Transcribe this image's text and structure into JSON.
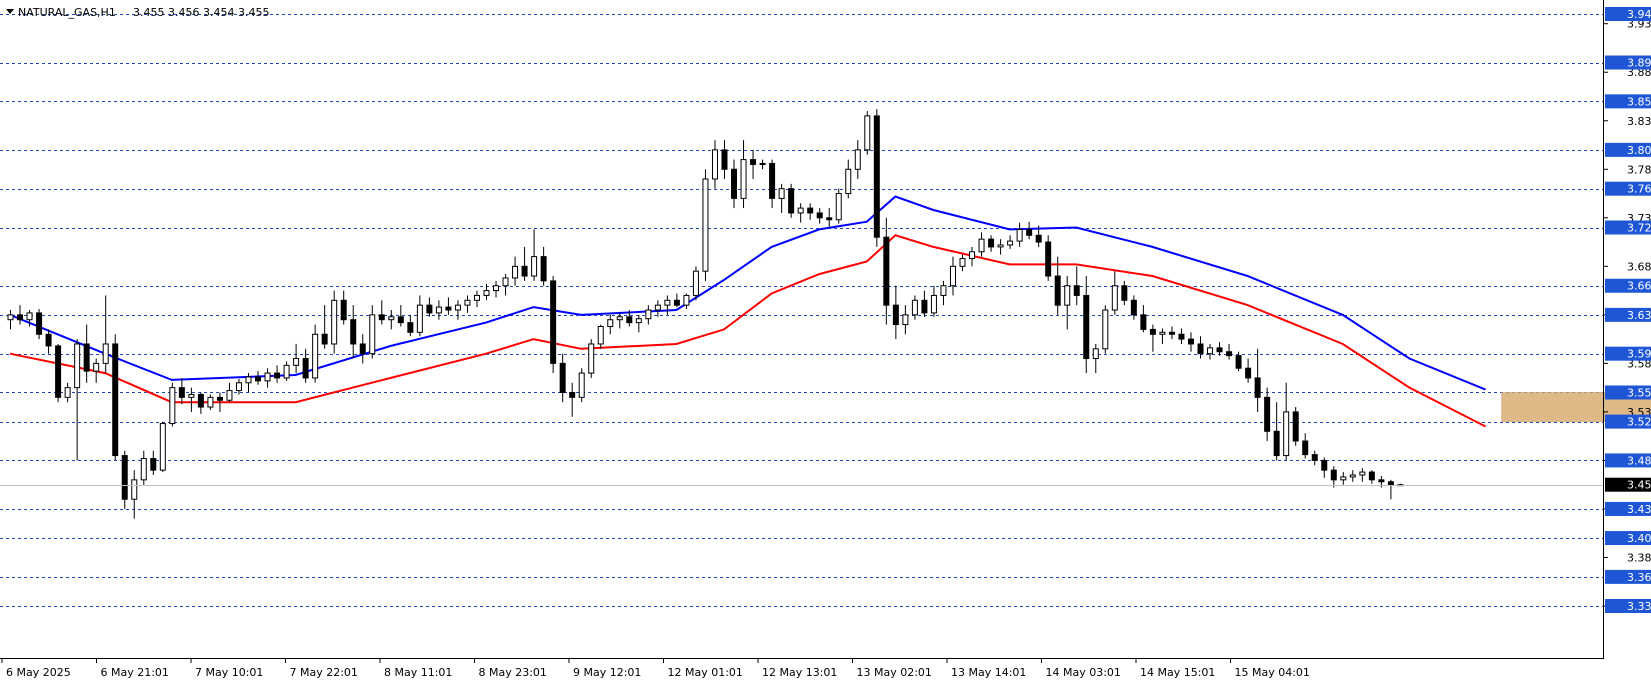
{
  "header": {
    "symbol": "NATURAL_GAS,H1",
    "ohlc": "3.455 3.456 3.454 3.455"
  },
  "colors": {
    "ema_fast": "#0000ff",
    "ema_slow": "#ff0000",
    "level_line": "#2244bb",
    "level_label_bg": "#1e56d6",
    "zone": "#deb887",
    "bid_label_bg": "#000000"
  },
  "chart_data": {
    "type": "candlestick",
    "ylim": [
      3.315,
      3.945
    ],
    "bid": 3.455,
    "price_ticks": [
      "3.930",
      "3.880",
      "3.830",
      "3.780",
      "3.730",
      "3.680",
      "3.630",
      "3.580",
      "3.530",
      "3.480",
      "3.430",
      "3.380",
      "3.330"
    ],
    "levels": [
      "3.940",
      "3.890",
      "3.850",
      "3.800",
      "3.760",
      "3.720",
      "3.660",
      "3.630",
      "3.590",
      "3.550",
      "3.520",
      "3.480",
      "3.430",
      "3.400",
      "3.360",
      "3.330"
    ],
    "time_labels": [
      "6 May 2025",
      "6 May 21:01",
      "7 May 10:01",
      "7 May 22:01",
      "8 May 11:01",
      "8 May 23:01",
      "9 May 12:01",
      "12 May 01:01",
      "12 May 13:01",
      "13 May 02:01",
      "13 May 14:01",
      "14 May 03:01",
      "14 May 15:01",
      "15 May 04:01"
    ],
    "zone": {
      "from_bar": 157,
      "to_bar": 205,
      "high": 3.55,
      "low": 3.52
    },
    "candles": [
      [
        3.625,
        3.635,
        3.615,
        3.63
      ],
      [
        3.63,
        3.64,
        3.62,
        3.625
      ],
      [
        3.625,
        3.635,
        3.618,
        3.632
      ],
      [
        3.632,
        3.636,
        3.605,
        3.61
      ],
      [
        3.61,
        3.615,
        3.59,
        3.598
      ],
      [
        3.598,
        3.6,
        3.54,
        3.545
      ],
      [
        3.545,
        3.56,
        3.54,
        3.555
      ],
      [
        3.555,
        3.605,
        3.48,
        3.6
      ],
      [
        3.6,
        3.62,
        3.56,
        3.572
      ],
      [
        3.572,
        3.585,
        3.56,
        3.58
      ],
      [
        3.58,
        3.65,
        3.57,
        3.6
      ],
      [
        3.6,
        3.61,
        3.48,
        3.485
      ],
      [
        3.485,
        3.49,
        3.43,
        3.44
      ],
      [
        3.44,
        3.47,
        3.42,
        3.46
      ],
      [
        3.46,
        3.49,
        3.455,
        3.482
      ],
      [
        3.482,
        3.49,
        3.465,
        3.47
      ],
      [
        3.47,
        3.52,
        3.468,
        3.518
      ],
      [
        3.518,
        3.56,
        3.515,
        3.555
      ],
      [
        3.555,
        3.565,
        3.538,
        3.545
      ],
      [
        3.545,
        3.555,
        3.53,
        3.548
      ],
      [
        3.548,
        3.55,
        3.528,
        3.535
      ],
      [
        3.535,
        3.548,
        3.532,
        3.545
      ],
      [
        3.545,
        3.55,
        3.53,
        3.542
      ],
      [
        3.542,
        3.56,
        3.54,
        3.552
      ],
      [
        3.552,
        3.564,
        3.548,
        3.56
      ],
      [
        3.56,
        3.57,
        3.55,
        3.566
      ],
      [
        3.566,
        3.572,
        3.558,
        3.562
      ],
      [
        3.562,
        3.575,
        3.555,
        3.57
      ],
      [
        3.57,
        3.578,
        3.56,
        3.565
      ],
      [
        3.565,
        3.582,
        3.562,
        3.578
      ],
      [
        3.578,
        3.6,
        3.57,
        3.585
      ],
      [
        3.585,
        3.595,
        3.56,
        3.565
      ],
      [
        3.565,
        3.62,
        3.56,
        3.61
      ],
      [
        3.61,
        3.64,
        3.595,
        3.6
      ],
      [
        3.6,
        3.655,
        3.59,
        3.645
      ],
      [
        3.645,
        3.655,
        3.62,
        3.625
      ],
      [
        3.625,
        3.64,
        3.585,
        3.6
      ],
      [
        3.6,
        3.61,
        3.58,
        3.59
      ],
      [
        3.59,
        3.64,
        3.585,
        3.63
      ],
      [
        3.63,
        3.645,
        3.62,
        3.625
      ],
      [
        3.625,
        3.635,
        3.615,
        3.628
      ],
      [
        3.628,
        3.64,
        3.618,
        3.622
      ],
      [
        3.622,
        3.63,
        3.608,
        3.612
      ],
      [
        3.612,
        3.65,
        3.608,
        3.64
      ],
      [
        3.64,
        3.648,
        3.628,
        3.632
      ],
      [
        3.632,
        3.645,
        3.625,
        3.638
      ],
      [
        3.638,
        3.648,
        3.63,
        3.635
      ],
      [
        3.635,
        3.645,
        3.625,
        3.64
      ],
      [
        3.64,
        3.65,
        3.632,
        3.645
      ],
      [
        3.645,
        3.655,
        3.638,
        3.65
      ],
      [
        3.65,
        3.662,
        3.645,
        3.655
      ],
      [
        3.655,
        3.665,
        3.648,
        3.66
      ],
      [
        3.66,
        3.672,
        3.65,
        3.668
      ],
      [
        3.668,
        3.69,
        3.66,
        3.68
      ],
      [
        3.68,
        3.7,
        3.665,
        3.67
      ],
      [
        3.67,
        3.718,
        3.665,
        3.69
      ],
      [
        3.69,
        3.7,
        3.66,
        3.665
      ],
      [
        3.665,
        3.67,
        3.57,
        3.58
      ],
      [
        3.58,
        3.59,
        3.54,
        3.55
      ],
      [
        3.55,
        3.56,
        3.525,
        3.545
      ],
      [
        3.545,
        3.575,
        3.54,
        3.57
      ],
      [
        3.57,
        3.605,
        3.565,
        3.6
      ],
      [
        3.6,
        3.62,
        3.595,
        3.618
      ],
      [
        3.618,
        3.63,
        3.61,
        3.625
      ],
      [
        3.625,
        3.632,
        3.616,
        3.628
      ],
      [
        3.628,
        3.635,
        3.618,
        3.622
      ],
      [
        3.622,
        3.63,
        3.612,
        3.626
      ],
      [
        3.626,
        3.64,
        3.62,
        3.635
      ],
      [
        3.635,
        3.645,
        3.628,
        3.64
      ],
      [
        3.64,
        3.65,
        3.63,
        3.645
      ],
      [
        3.645,
        3.652,
        3.638,
        3.64
      ],
      [
        3.64,
        3.652,
        3.636,
        3.65
      ],
      [
        3.65,
        3.68,
        3.645,
        3.675
      ],
      [
        3.675,
        3.78,
        3.665,
        3.77
      ],
      [
        3.77,
        3.81,
        3.76,
        3.8
      ],
      [
        3.8,
        3.81,
        3.77,
        3.78
      ],
      [
        3.78,
        3.79,
        3.74,
        3.75
      ],
      [
        3.75,
        3.81,
        3.74,
        3.79
      ],
      [
        3.79,
        3.8,
        3.77,
        3.785
      ],
      [
        3.785,
        3.79,
        3.78,
        3.786
      ],
      [
        3.786,
        3.79,
        3.74,
        3.75
      ],
      [
        3.75,
        3.765,
        3.735,
        3.76
      ],
      [
        3.76,
        3.765,
        3.73,
        3.735
      ],
      [
        3.735,
        3.745,
        3.725,
        3.74
      ],
      [
        3.74,
        3.745,
        3.728,
        3.735
      ],
      [
        3.735,
        3.74,
        3.724,
        3.73
      ],
      [
        3.73,
        3.74,
        3.72,
        3.728
      ],
      [
        3.728,
        3.76,
        3.724,
        3.755
      ],
      [
        3.755,
        3.79,
        3.75,
        3.78
      ],
      [
        3.78,
        3.81,
        3.77,
        3.8
      ],
      [
        3.8,
        3.84,
        3.795,
        3.835
      ],
      [
        3.835,
        3.842,
        3.7,
        3.71
      ],
      [
        3.71,
        3.73,
        3.62,
        3.64
      ],
      [
        3.64,
        3.66,
        3.605,
        3.62
      ],
      [
        3.62,
        3.64,
        3.61,
        3.63
      ],
      [
        3.63,
        3.65,
        3.625,
        3.645
      ],
      [
        3.645,
        3.655,
        3.628,
        3.632
      ],
      [
        3.632,
        3.66,
        3.628,
        3.65
      ],
      [
        3.65,
        3.665,
        3.64,
        3.66
      ],
      [
        3.66,
        3.69,
        3.65,
        3.68
      ],
      [
        3.68,
        3.692,
        3.675,
        3.688
      ],
      [
        3.688,
        3.7,
        3.68,
        3.695
      ],
      [
        3.695,
        3.715,
        3.69,
        3.708
      ],
      [
        3.708,
        3.712,
        3.695,
        3.7
      ],
      [
        3.7,
        3.708,
        3.692,
        3.702
      ],
      [
        3.702,
        3.712,
        3.698,
        3.706
      ],
      [
        3.706,
        3.725,
        3.7,
        3.718
      ],
      [
        3.718,
        3.726,
        3.708,
        3.712
      ],
      [
        3.712,
        3.722,
        3.7,
        3.705
      ],
      [
        3.705,
        3.712,
        3.665,
        3.67
      ],
      [
        3.67,
        3.69,
        3.63,
        3.64
      ],
      [
        3.64,
        3.67,
        3.615,
        3.66
      ],
      [
        3.66,
        3.68,
        3.64,
        3.65
      ],
      [
        3.65,
        3.67,
        3.57,
        3.585
      ],
      [
        3.585,
        3.6,
        3.57,
        3.595
      ],
      [
        3.595,
        3.64,
        3.59,
        3.635
      ],
      [
        3.635,
        3.675,
        3.63,
        3.66
      ],
      [
        3.66,
        3.665,
        3.64,
        3.645
      ],
      [
        3.645,
        3.65,
        3.625,
        3.63
      ],
      [
        3.63,
        3.64,
        3.612,
        3.615
      ],
      [
        3.615,
        3.62,
        3.592,
        3.61
      ],
      [
        3.61,
        3.616,
        3.6,
        3.612
      ],
      [
        3.612,
        3.618,
        3.605,
        3.61
      ],
      [
        3.61,
        3.616,
        3.6,
        3.605
      ],
      [
        3.605,
        3.612,
        3.592,
        3.6
      ],
      [
        3.6,
        3.608,
        3.585,
        3.59
      ],
      [
        3.59,
        3.6,
        3.584,
        3.596
      ],
      [
        3.596,
        3.602,
        3.588,
        3.592
      ],
      [
        3.592,
        3.6,
        3.584,
        3.588
      ],
      [
        3.588,
        3.592,
        3.572,
        3.575
      ],
      [
        3.575,
        3.585,
        3.56,
        3.565
      ],
      [
        3.565,
        3.595,
        3.53,
        3.545
      ],
      [
        3.545,
        3.555,
        3.5,
        3.51
      ],
      [
        3.51,
        3.54,
        3.48,
        3.485
      ],
      [
        3.485,
        3.56,
        3.48,
        3.53
      ],
      [
        3.53,
        3.535,
        3.495,
        3.5
      ],
      [
        3.5,
        3.508,
        3.482,
        3.486
      ],
      [
        3.486,
        3.49,
        3.475,
        3.48
      ],
      [
        3.48,
        3.483,
        3.462,
        3.47
      ],
      [
        3.47,
        3.474,
        3.452,
        3.46
      ],
      [
        3.46,
        3.468,
        3.455,
        3.463
      ],
      [
        3.463,
        3.47,
        3.458,
        3.465
      ],
      [
        3.465,
        3.472,
        3.458,
        3.468
      ],
      [
        3.468,
        3.47,
        3.456,
        3.46
      ],
      [
        3.46,
        3.464,
        3.452,
        3.458
      ],
      [
        3.458,
        3.46,
        3.44,
        3.455
      ],
      [
        3.455,
        3.456,
        3.454,
        3.455
      ]
    ],
    "ema_fast": [
      [
        0,
        3.63
      ],
      [
        10,
        3.59
      ],
      [
        17,
        3.563
      ],
      [
        30,
        3.568
      ],
      [
        40,
        3.598
      ],
      [
        50,
        3.622
      ],
      [
        55,
        3.638
      ],
      [
        60,
        3.63
      ],
      [
        70,
        3.635
      ],
      [
        75,
        3.666
      ],
      [
        80,
        3.7
      ],
      [
        85,
        3.718
      ],
      [
        90,
        3.726
      ],
      [
        93,
        3.752
      ],
      [
        97,
        3.738
      ],
      [
        105,
        3.718
      ],
      [
        112,
        3.72
      ],
      [
        120,
        3.7
      ],
      [
        130,
        3.67
      ],
      [
        140,
        3.63
      ],
      [
        147,
        3.585
      ],
      [
        155,
        3.553
      ]
    ],
    "ema_slow": [
      [
        0,
        3.59
      ],
      [
        10,
        3.57
      ],
      [
        17,
        3.54
      ],
      [
        30,
        3.54
      ],
      [
        40,
        3.565
      ],
      [
        50,
        3.59
      ],
      [
        55,
        3.605
      ],
      [
        60,
        3.595
      ],
      [
        70,
        3.6
      ],
      [
        75,
        3.615
      ],
      [
        80,
        3.652
      ],
      [
        85,
        3.672
      ],
      [
        90,
        3.685
      ],
      [
        93,
        3.712
      ],
      [
        97,
        3.7
      ],
      [
        105,
        3.682
      ],
      [
        112,
        3.682
      ],
      [
        120,
        3.67
      ],
      [
        130,
        3.64
      ],
      [
        140,
        3.6
      ],
      [
        147,
        3.555
      ],
      [
        155,
        3.515
      ]
    ]
  }
}
